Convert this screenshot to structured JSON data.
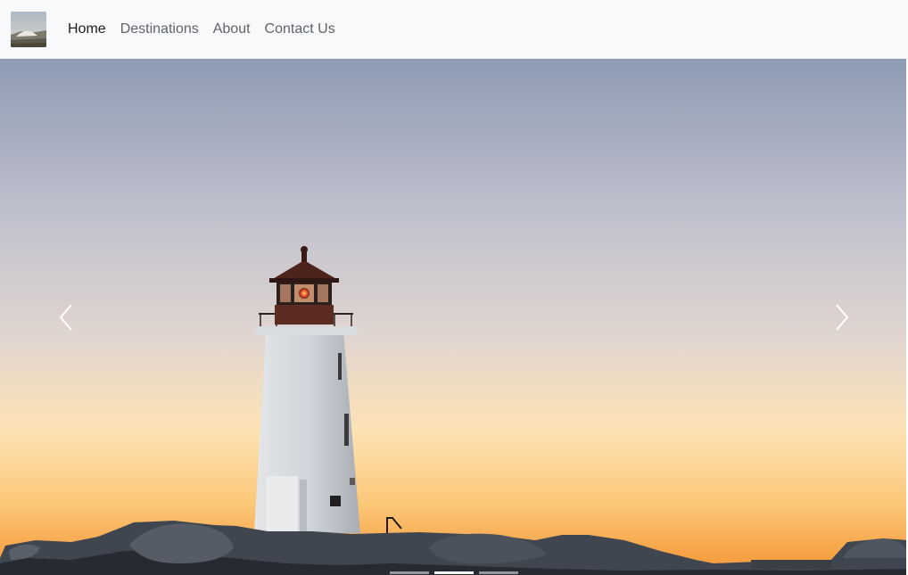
{
  "navbar": {
    "brand_icon": "landscape-thumbnail-icon",
    "items": [
      {
        "label": "Home",
        "active": true
      },
      {
        "label": "Destinations",
        "active": false
      },
      {
        "label": "About",
        "active": false
      },
      {
        "label": "Contact Us",
        "active": false
      }
    ]
  },
  "carousel": {
    "slide_subject": "lighthouse-at-sunset",
    "prev_icon": "chevron-left-icon",
    "next_icon": "chevron-right-icon",
    "slide_count": 3,
    "active_slide": 1
  },
  "colors": {
    "navbar_bg": "#f8f9fa",
    "nav_active": "#1e1e1e",
    "nav_inactive": "#5f6368",
    "sky_top": "#8e9bb3",
    "sky_mid": "#d8d2d4",
    "sky_low": "#fde2b4",
    "horizon": "#f7a245"
  }
}
